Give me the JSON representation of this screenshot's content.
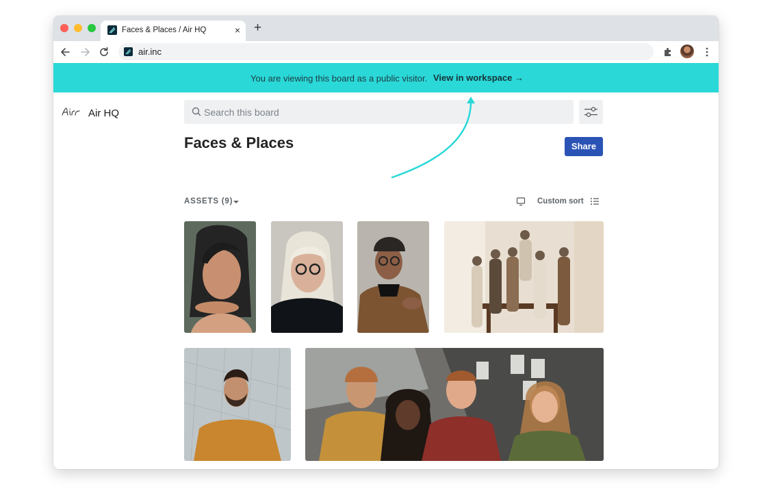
{
  "browser": {
    "tab_title": "Faces & Places / Air HQ",
    "tab_close": "×",
    "new_tab": "+",
    "url": "air.inc"
  },
  "banner": {
    "message": "You are viewing this board as a public visitor.",
    "link_label": "View in workspace →",
    "color": "#2ad8d8"
  },
  "sidebar": {
    "workspace_name": "Air HQ"
  },
  "search": {
    "placeholder": "Search this board"
  },
  "board": {
    "title": "Faces & Places",
    "share_label": "Share"
  },
  "assets": {
    "label": "ASSETS (9)",
    "sort_label": "Custom sort",
    "items": [
      {
        "name": "portrait-freckled-woman"
      },
      {
        "name": "portrait-blonde-woman-glasses"
      },
      {
        "name": "portrait-man-beanie-glasses"
      },
      {
        "name": "group-six-women"
      },
      {
        "name": "portrait-bearded-man-mustard-shirt"
      },
      {
        "name": "group-four-friends"
      }
    ]
  },
  "colors": {
    "accent": "#2a53b5",
    "arrow": "#2ad8d8"
  }
}
